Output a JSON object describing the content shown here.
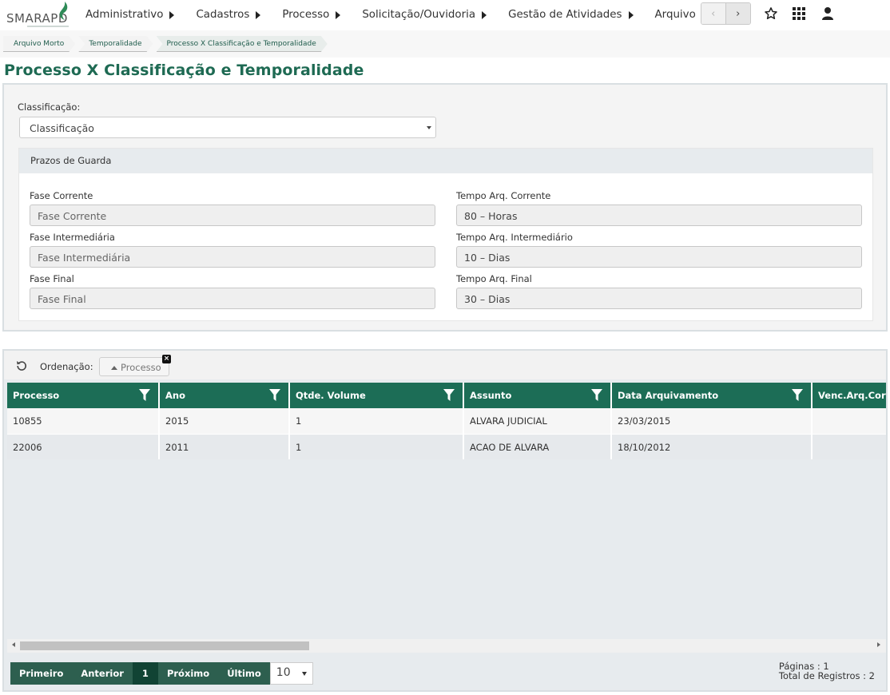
{
  "header": {
    "logo_text": "SMARAPD",
    "menu": [
      {
        "label": "Administrativo"
      },
      {
        "label": "Cadastros"
      },
      {
        "label": "Processo"
      },
      {
        "label": "Solicitação/Ouvidoria"
      },
      {
        "label": "Gestão de Atividades"
      },
      {
        "label": "Arquivo"
      }
    ],
    "nav_prev": "‹",
    "nav_next": "›",
    "icons": [
      "star-icon",
      "grid-apps-icon",
      "user-icon"
    ]
  },
  "breadcrumb": [
    "Arquivo Morto",
    "Temporalidade",
    "Processo X Classificação e Temporalidade"
  ],
  "page_title": "Processo X Classificação e Temporalidade",
  "form": {
    "classificacao_label": "Classificação:",
    "classificacao_value": "Classificação",
    "section_title": "Prazos de Guarda",
    "fase_corrente_label": "Fase Corrente",
    "fase_corrente_placeholder": "Fase Corrente",
    "fase_intermediaria_label": "Fase Intermediária",
    "fase_intermediaria_placeholder": "Fase Intermediária",
    "fase_final_label": "Fase Final",
    "fase_final_placeholder": "Fase Final",
    "tempo_corrente_label": "Tempo Arq. Corrente",
    "tempo_corrente_value": "80 – Horas",
    "tempo_intermediario_label": "Tempo Arq. Intermediário",
    "tempo_intermediario_value": "10 – Dias",
    "tempo_final_label": "Tempo Arq. Final",
    "tempo_final_value": "30 – Dias"
  },
  "grid": {
    "ordering_label": "Ordenação:",
    "ordering_chip": "Processo",
    "columns": [
      "Processo",
      "Ano",
      "Qtde. Volume",
      "Assunto",
      "Data Arquivamento",
      "Venc.Arq.Corr"
    ],
    "rows": [
      [
        "10855",
        "2015",
        "1",
        "ALVARA JUDICIAL",
        "23/03/2015",
        ""
      ],
      [
        "22006",
        "2011",
        "1",
        "ACAO DE ALVARA",
        "18/10/2012",
        ""
      ]
    ],
    "pager": {
      "first": "Primeiro",
      "prev": "Anterior",
      "current": "1",
      "next": "Próximo",
      "last": "Último",
      "page_size": "10",
      "pages_text": "Páginas : 1",
      "total_text": "Total de Registros : 2"
    }
  },
  "colors": {
    "brand_green": "#1c6d56",
    "title_green": "#1e6a53",
    "pager_green": "#2d5f4f",
    "pager_current": "#114334"
  }
}
